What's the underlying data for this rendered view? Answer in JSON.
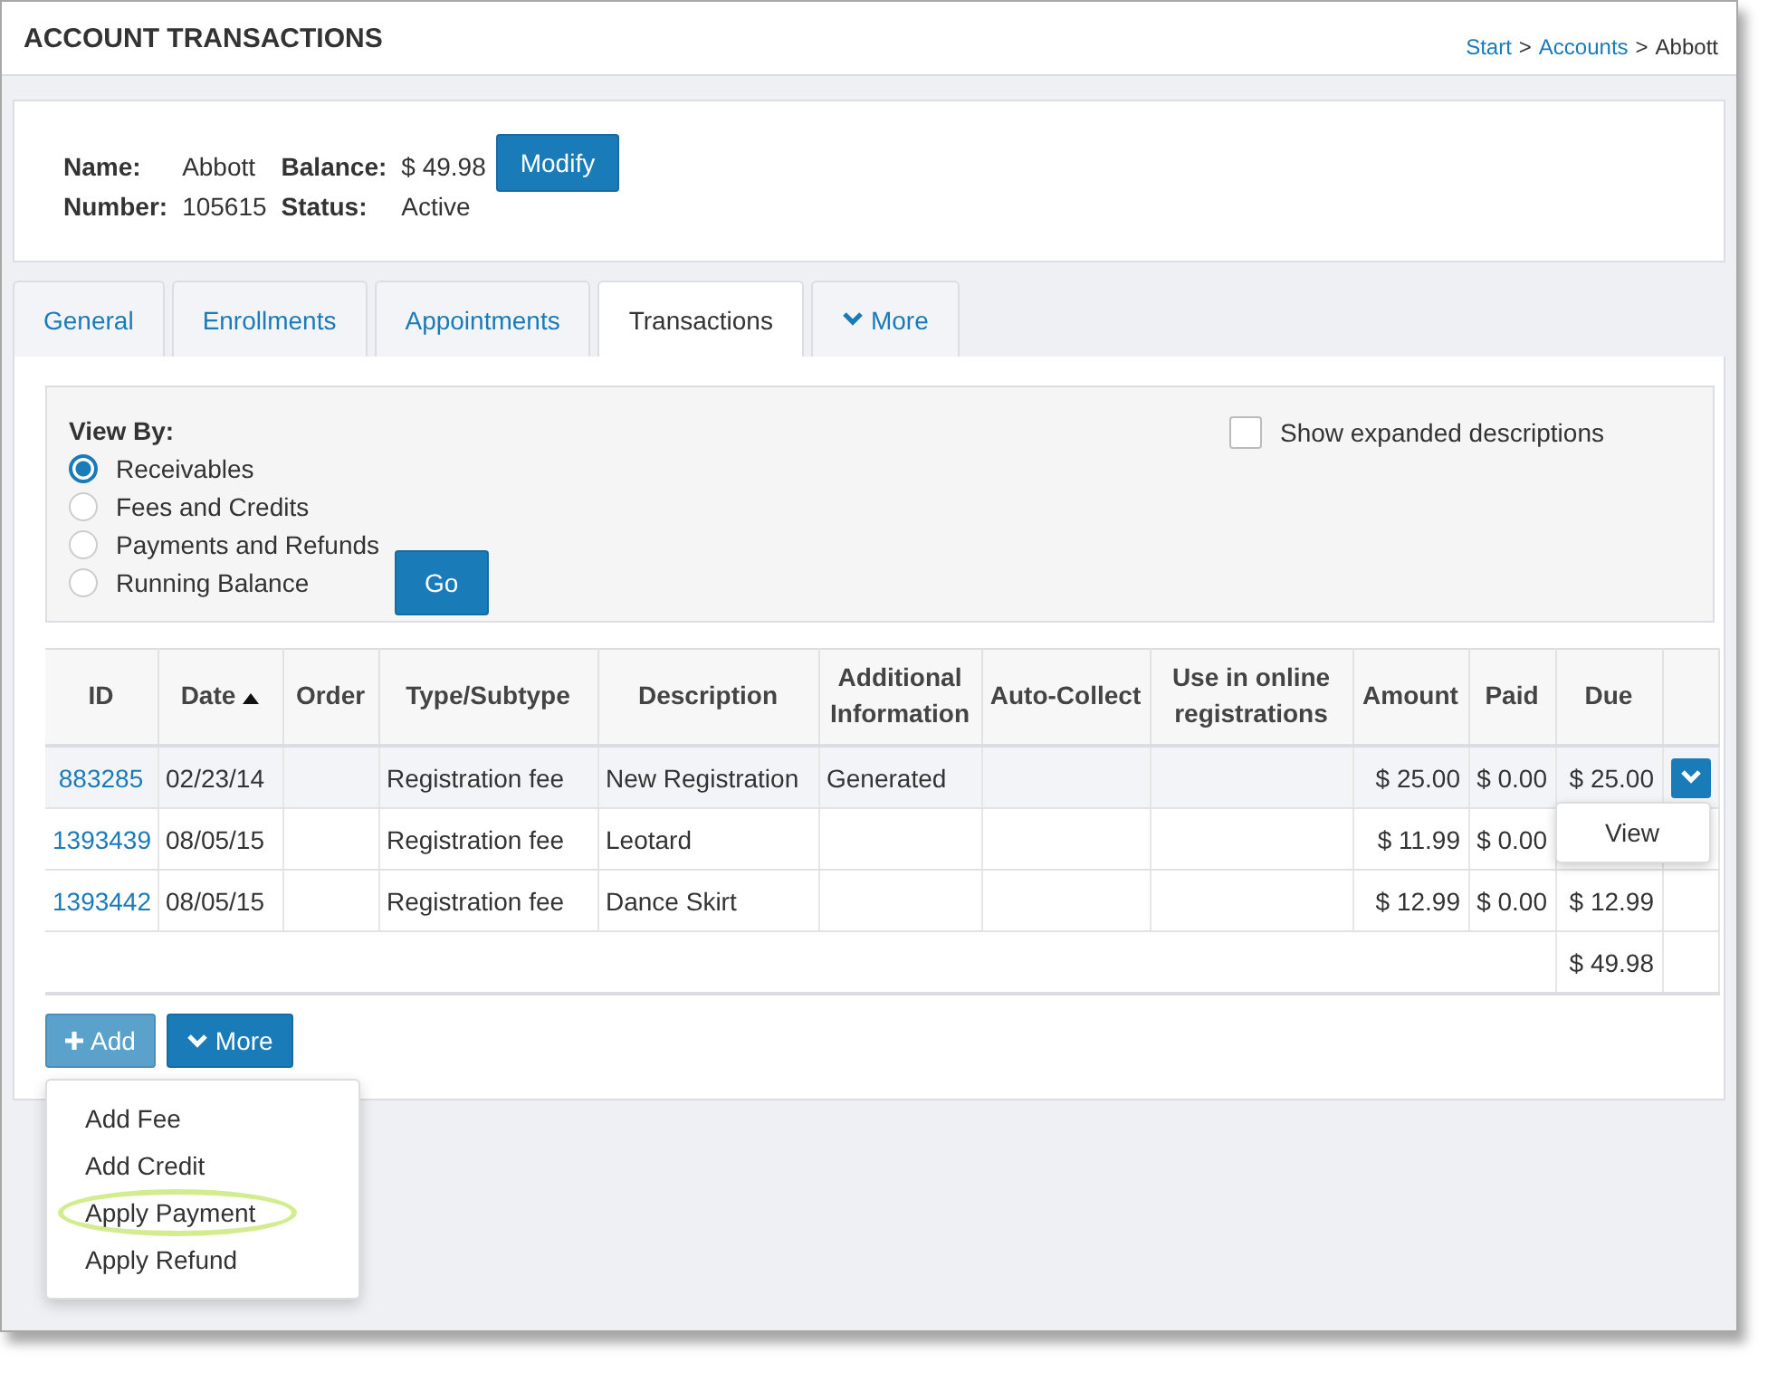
{
  "header": {
    "title": "ACCOUNT TRANSACTIONS",
    "breadcrumb": [
      {
        "label": "Start",
        "link": true
      },
      {
        "label": "Accounts",
        "link": true
      },
      {
        "label": "Abbott",
        "link": false
      }
    ],
    "separator": ">"
  },
  "account": {
    "fields": [
      {
        "label": "Name:",
        "value": "Abbott"
      },
      {
        "label": "Balance:",
        "value": "$ 49.98"
      },
      {
        "label": "Number:",
        "value": "105615"
      },
      {
        "label": "Status:",
        "value": "Active"
      }
    ],
    "button": "Modify"
  },
  "tabs": [
    {
      "label": "General",
      "selected": false,
      "caret": false
    },
    {
      "label": "Enrollments",
      "selected": false,
      "caret": false
    },
    {
      "label": "Appointments",
      "selected": false,
      "caret": false
    },
    {
      "label": "Transactions",
      "selected": true,
      "caret": false
    },
    {
      "label": "More",
      "selected": false,
      "caret": true
    }
  ],
  "view_by": {
    "label": "View By:",
    "options": [
      {
        "label": "Receivables",
        "selected": true
      },
      {
        "label": "Fees and Credits",
        "selected": false
      },
      {
        "label": "Payments and Refunds",
        "selected": false
      },
      {
        "label": "Running Balance",
        "selected": false
      }
    ],
    "go_button": "Go",
    "expanded": {
      "label": "Show expanded descriptions",
      "checked": false
    }
  },
  "table": {
    "columns": [
      {
        "label": "ID",
        "sorted": false
      },
      {
        "label": "Date",
        "sorted": true
      },
      {
        "label": "Order",
        "sorted": false
      },
      {
        "label": "Type/Subtype",
        "sorted": false
      },
      {
        "label": "Description",
        "sorted": false
      },
      {
        "label": "Additional Information",
        "sorted": false
      },
      {
        "label": "Auto-Collect",
        "sorted": false
      },
      {
        "label": "Use in online registrations",
        "sorted": false
      },
      {
        "label": "Amount",
        "sorted": false
      },
      {
        "label": "Paid",
        "sorted": false
      },
      {
        "label": "Due",
        "sorted": false
      }
    ],
    "rows": [
      {
        "id": "883285",
        "date": "02/23/14",
        "type": "Registration fee",
        "description": "New Registration",
        "additional": "Generated",
        "amount": "$ 25.00",
        "paid": "$ 0.00",
        "due": "$ 25.00",
        "selected": true,
        "menu_open": true,
        "menu": [
          "View"
        ]
      },
      {
        "id": "1393439",
        "date": "08/05/15",
        "type": "Registration fee",
        "description": "Leotard",
        "amount": "$ 11.99",
        "paid": "$ 0.00",
        "selected": false,
        "menu_open": false
      },
      {
        "id": "1393442",
        "date": "08/05/15",
        "type": "Registration fee",
        "description": "Dance Skirt",
        "amount": "$ 12.99",
        "paid": "$ 0.00",
        "due": "$ 12.99",
        "selected": false,
        "menu_open": false
      }
    ],
    "total_due": "$ 49.98"
  },
  "actions": [
    {
      "label": "Add",
      "kind": "plus",
      "menu_open": true,
      "menu": [
        {
          "label": "Add Fee",
          "circled": false
        },
        {
          "label": "Add Credit",
          "circled": false
        },
        {
          "label": "Apply Payment",
          "circled": true
        },
        {
          "label": "Apply Refund",
          "circled": false
        }
      ]
    },
    {
      "label": "More",
      "kind": "chevron",
      "menu_open": false
    }
  ]
}
